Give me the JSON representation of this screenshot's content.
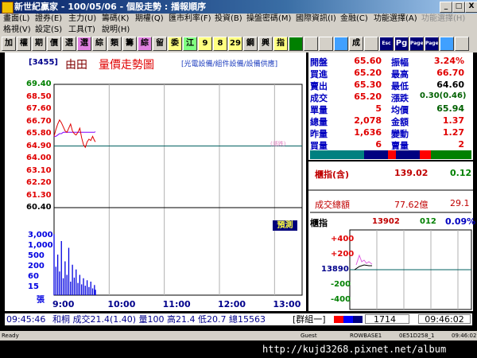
{
  "window": {
    "title": "新世紀贏家 - 100/05/06 - 個股走勢 : 播報順序",
    "buttons": [
      "_",
      "□",
      "X"
    ]
  },
  "menu": {
    "row1": [
      {
        "label": "畫面(L)",
        "disabled": false
      },
      {
        "label": "證券(E)",
        "disabled": false
      },
      {
        "label": "主力(U)",
        "disabled": false
      },
      {
        "label": "籌碼(K)",
        "disabled": false
      },
      {
        "label": "期權(Q)",
        "disabled": false
      },
      {
        "label": "匯市利率(F)",
        "disabled": false
      },
      {
        "label": "投資(B)",
        "disabled": false
      },
      {
        "label": "操盤密碼(M)",
        "disabled": false
      },
      {
        "label": "國際資訊(I)",
        "disabled": false
      },
      {
        "label": "金融(C)",
        "disabled": false
      },
      {
        "label": "功能選擇(A)",
        "disabled": false
      },
      {
        "label": "功能選擇(H)",
        "disabled": true
      }
    ],
    "row2": [
      {
        "label": "格視(V)",
        "disabled": false
      },
      {
        "label": "設定(S)",
        "disabled": false
      },
      {
        "label": "工具(T)",
        "disabled": false
      },
      {
        "label": "說明(H)",
        "disabled": false
      }
    ]
  },
  "toolbar": [
    {
      "label": "加",
      "bg": "#d4d0c8",
      "fg": "#000"
    },
    {
      "label": "權",
      "bg": "#d4d0c8",
      "fg": "#000"
    },
    {
      "label": "期",
      "bg": "#d4d0c8",
      "fg": "#000"
    },
    {
      "label": "價",
      "bg": "#d4d0c8",
      "fg": "#000"
    },
    {
      "label": "選",
      "bg": "#d4d0c8",
      "fg": "#000"
    },
    {
      "label": "選",
      "bg": "#e080e0",
      "fg": "#000"
    },
    {
      "label": "綜",
      "bg": "#d4d0c8",
      "fg": "#000"
    },
    {
      "label": "類",
      "bg": "#d4d0c8",
      "fg": "#000"
    },
    {
      "label": "籌",
      "bg": "#d4d0c8",
      "fg": "#000"
    },
    {
      "label": "綜",
      "bg": "#e080e0",
      "fg": "#000"
    },
    {
      "label": "留",
      "bg": "#d4d0c8",
      "fg": "#000"
    },
    {
      "label": "委",
      "bg": "#ffff80",
      "fg": "#000"
    },
    {
      "label": "江",
      "bg": "#80ff80",
      "fg": "#000"
    },
    {
      "label": "9",
      "bg": "#ffff80",
      "fg": "#000"
    },
    {
      "label": "8",
      "bg": "#ffff80",
      "fg": "#000"
    },
    {
      "label": "29",
      "bg": "#ffff80",
      "fg": "#000"
    },
    {
      "label": "鋼",
      "bg": "#d4d0c8",
      "fg": "#000"
    },
    {
      "label": "興",
      "bg": "#d4d0c8",
      "fg": "#000"
    },
    {
      "label": "指",
      "bg": "#ffff80",
      "fg": "#000"
    },
    {
      "label": "",
      "bg": "#008000",
      "fg": "#fff"
    },
    {
      "label": "",
      "bg": "#d4d0c8",
      "fg": "#000"
    },
    {
      "label": "",
      "bg": "#d4d0c8",
      "fg": "#000"
    },
    {
      "label": "",
      "bg": "#40a0ff",
      "fg": "#fff"
    },
    {
      "label": "成",
      "bg": "#d4d0c8",
      "fg": "#000"
    },
    {
      "label": "",
      "bg": "#d4d0c8",
      "fg": "#000"
    },
    {
      "label": "Esc",
      "bg": "#00007a",
      "fg": "#fff"
    },
    {
      "label": "Pg",
      "bg": "#00007a",
      "fg": "#fff"
    },
    {
      "label": "Page",
      "bg": "#00007a",
      "fg": "#fff"
    },
    {
      "label": "Page",
      "bg": "#00007a",
      "fg": "#fff"
    },
    {
      "label": "",
      "bg": "#40a0ff",
      "fg": "#fff"
    },
    {
      "label": "",
      "bg": "#d4d0c8",
      "fg": "#000"
    }
  ],
  "chart": {
    "code": "[3455]",
    "name": "由田",
    "title": "量價走勢圖",
    "subtitle": "[光電設備/組件設備/設備供應]",
    "predict_button": "預測",
    "small_legend": "(漲跌)"
  },
  "chart_data": {
    "type": "line",
    "price_ticks": [
      "69.40",
      "68.50",
      "67.60",
      "66.70",
      "65.80",
      "64.90",
      "64.00",
      "63.10",
      "62.20",
      "61.30",
      "60.40"
    ],
    "price_tick_colors": [
      "green",
      "red",
      "red",
      "red",
      "red",
      "red",
      "red",
      "red",
      "red",
      "red",
      "black"
    ],
    "volume_ticks": [
      "3,000",
      "1,000",
      "500",
      "200",
      "60",
      "15",
      "張"
    ],
    "time_ticks": [
      "9:00",
      "10:00",
      "11:00",
      "12:00",
      "13:00"
    ],
    "reference_price": 64.9,
    "ylim": [
      60.4,
      69.4
    ],
    "x_range": [
      "9:00",
      "13:30"
    ],
    "price_series": {
      "x": [
        "9:00",
        "9:02",
        "9:04",
        "9:06",
        "9:08",
        "9:10",
        "9:12",
        "9:14",
        "9:16",
        "9:18",
        "9:20",
        "9:22",
        "9:24",
        "9:26",
        "9:28",
        "9:30",
        "9:32",
        "9:34",
        "9:36",
        "9:38",
        "9:40",
        "9:42",
        "9:44",
        "9:45"
      ],
      "values": [
        65.6,
        66.1,
        66.5,
        66.8,
        66.6,
        66.3,
        66.0,
        65.9,
        66.2,
        66.5,
        66.0,
        65.8,
        65.7,
        65.9,
        66.2,
        65.5,
        65.0,
        64.8,
        65.2,
        65.4,
        65.3,
        65.6,
        65.3,
        65.2
      ],
      "color": "#e00000"
    },
    "avg_series": {
      "values": [
        65.6,
        65.6,
        65.7,
        65.8,
        65.8,
        65.9,
        65.9,
        65.9,
        65.9,
        65.9,
        65.9,
        65.9,
        65.9,
        65.9,
        65.9,
        65.9,
        65.9,
        65.9,
        65.9,
        65.9,
        65.9,
        65.9,
        65.9,
        65.94
      ],
      "color": "#8000ff"
    },
    "volume_series": {
      "values": [
        900,
        420,
        600,
        350,
        800,
        250,
        500,
        300,
        700,
        200,
        450,
        260,
        380,
        180,
        300,
        160,
        250,
        140,
        220,
        120,
        200,
        100,
        150,
        80
      ],
      "color": "#0000e0"
    }
  },
  "quote": {
    "rows": [
      {
        "l1": "開盤",
        "v1": "65.60",
        "c1": "red",
        "l2": "振幅",
        "v2": "3.24%",
        "c2": "red"
      },
      {
        "l1": "買進",
        "v1": "65.20",
        "c1": "red",
        "l2": "最高",
        "v2": "66.70",
        "c2": "red"
      },
      {
        "l1": "賣出",
        "v1": "65.30",
        "c1": "red",
        "l2": "最低",
        "v2": "64.60",
        "c2": "black"
      },
      {
        "l1": "成交",
        "v1": "65.20",
        "c1": "red",
        "l2": "漲跌",
        "v2": "0.30(0.46)",
        "c2": "green"
      },
      {
        "l1": "單量",
        "v1": "5",
        "c1": "red",
        "l2": "均價",
        "v2": "65.94",
        "c2": "green"
      },
      {
        "l1": "總量",
        "v1": "2,078",
        "c1": "red",
        "l2": "金額",
        "v2": "1.37",
        "c2": "red"
      },
      {
        "l1": "昨量",
        "v1": "1,636",
        "c1": "red",
        "l2": "變動",
        "v2": "1.27",
        "c2": "red"
      },
      {
        "l1": "買量",
        "v1": "6",
        "c1": "red",
        "l2": "賣量",
        "v2": "2",
        "c2": "red"
      }
    ]
  },
  "index_panel": {
    "label1": "櫃指(含)",
    "v1a": "139.02",
    "v1b": "0.12",
    "label2": "成交總額",
    "v2a": "77.62億",
    "v2b": "29.1",
    "label3": "櫃指",
    "v3a": "13902",
    "v3b": "012",
    "v3c": "0.09%",
    "ticks": [
      "+400",
      "+200",
      "13890",
      "-200",
      "-400"
    ]
  },
  "footer": {
    "time": "09:45:46",
    "text": "和桐  成交21.4(1.40)  量100  高21.4  低20.7  總15563",
    "group": "[群組一]",
    "code": "1714",
    "clock": "09:46:02"
  },
  "status": {
    "left": "Ready",
    "user": "Guest",
    "server": "ROWBASE1",
    "id": "0E51D258_1",
    "time": "09:46:02"
  },
  "watermark": "http://kujd3268.pixnet.net/album"
}
